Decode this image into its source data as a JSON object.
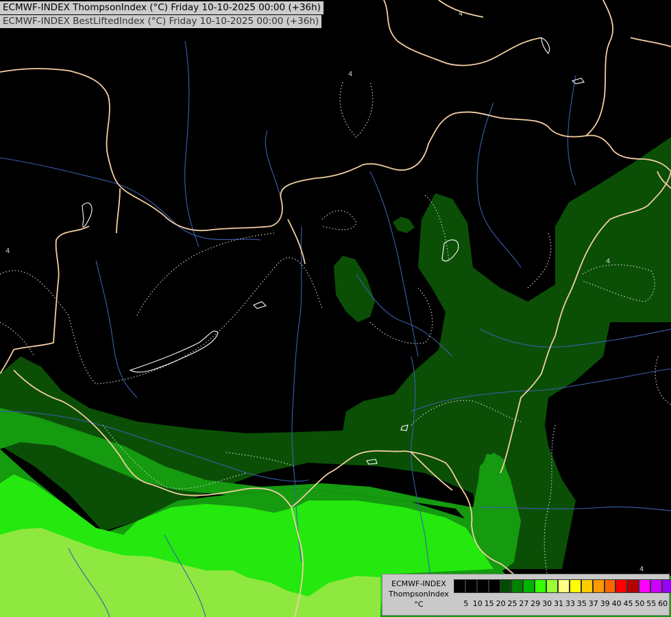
{
  "header": {
    "title_line_1": "ECMWF-INDEX ThompsonIndex (°C) Friday 10-10-2025 00:00 (+36h)",
    "title_line_2": "ECMWF-INDEX BestLiftedIndex (°C) Friday 10-10-2025 00:00 (+36h)"
  },
  "map": {
    "background_color": "#000000",
    "border_color": "#f3cfa2",
    "river_color": "#3b5fb0",
    "lake_outline_color": "#ffffff",
    "contour_color": "#cfcfcf",
    "contour_labels": [
      "4",
      "4",
      "4",
      "4",
      "4"
    ]
  },
  "legend": {
    "model": "ECMWF-INDEX",
    "parameter": "ThompsonIndex",
    "unit": "°C",
    "colors": [
      "#000000",
      "#000000",
      "#000000",
      "#000000",
      "#004d00",
      "#008000",
      "#00b300",
      "#33ff00",
      "#99ff33",
      "#ffff80",
      "#ffff00",
      "#ffcc00",
      "#ff9900",
      "#ff6600",
      "#ff0000",
      "#b30000",
      "#ff00ff",
      "#cc00ff",
      "#9900ff",
      "#6600ff",
      "#0000ff"
    ],
    "ticks": [
      "5",
      "10",
      "15",
      "20",
      "25",
      "27",
      "29",
      "30",
      "31",
      "33",
      "35",
      "37",
      "39",
      "40",
      "45",
      "50",
      "55",
      "60"
    ]
  }
}
